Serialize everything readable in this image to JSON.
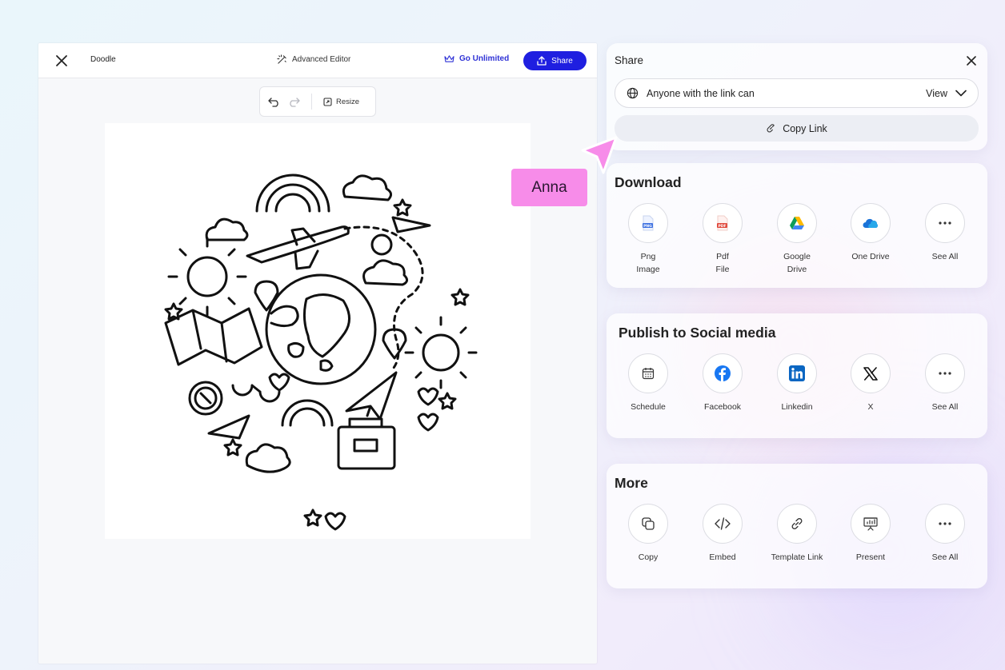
{
  "editor": {
    "doc_title": "Doodle",
    "advanced_editor_label": "Advanced Editor",
    "go_unlimited_label": "Go Unlimited",
    "share_label": "Share",
    "resize_label": "Resize"
  },
  "share_panel": {
    "title": "Share",
    "access_label": "Anyone with the link can",
    "access_permission": "View",
    "copy_link_label": "Copy Link"
  },
  "download": {
    "title": "Download",
    "items": [
      {
        "label": "Png\nImage",
        "icon": "png-file-icon"
      },
      {
        "label": "Pdf\nFile",
        "icon": "pdf-file-icon"
      },
      {
        "label": "Google\nDrive",
        "icon": "google-drive-icon"
      },
      {
        "label": "One Drive",
        "icon": "onedrive-icon"
      },
      {
        "label": "See All",
        "icon": "more-icon"
      }
    ]
  },
  "social": {
    "title": "Publish to Social media",
    "items": [
      {
        "label": "Schedule",
        "icon": "calendar-icon"
      },
      {
        "label": "Facebook",
        "icon": "facebook-icon"
      },
      {
        "label": "Linkedin",
        "icon": "linkedin-icon"
      },
      {
        "label": "X",
        "icon": "x-icon"
      },
      {
        "label": "See All",
        "icon": "more-icon"
      }
    ]
  },
  "more": {
    "title": "More",
    "items": [
      {
        "label": "Copy",
        "icon": "copy-icon"
      },
      {
        "label": "Embed",
        "icon": "code-icon"
      },
      {
        "label": "Template Link",
        "icon": "link-icon"
      },
      {
        "label": "Present",
        "icon": "presentation-icon"
      },
      {
        "label": "See All",
        "icon": "more-icon"
      }
    ]
  },
  "collaborator": {
    "name": "Anna",
    "color": "#f78ce9"
  },
  "colors": {
    "accent": "#1f1fe0",
    "accent_text": "#2f32d6"
  }
}
